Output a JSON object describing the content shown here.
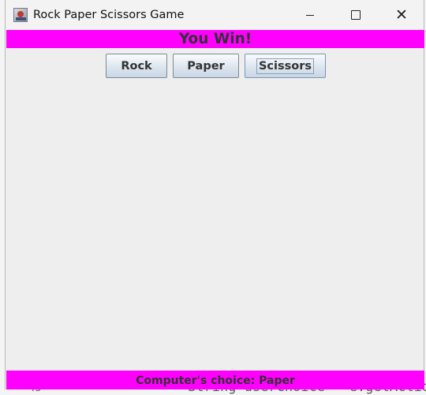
{
  "window": {
    "title": "Rock Paper Scissors Game",
    "controls": {
      "minimize": "minimize",
      "maximize": "maximize",
      "close": "✕"
    }
  },
  "result": {
    "text": "You Win!"
  },
  "buttons": {
    "rock": "Rock",
    "paper": "Paper",
    "scissors": "Scissors"
  },
  "computer": {
    "text": "Computer's choice: Paper"
  },
  "background": {
    "code_text": "String userChoice = e.getActionC",
    "line_text": "45"
  },
  "colors": {
    "banner": "#ff00ff",
    "window_bg": "#eeeeee"
  },
  "icons": [
    "java-app-icon",
    "minimize-icon",
    "maximize-icon",
    "close-icon"
  ]
}
